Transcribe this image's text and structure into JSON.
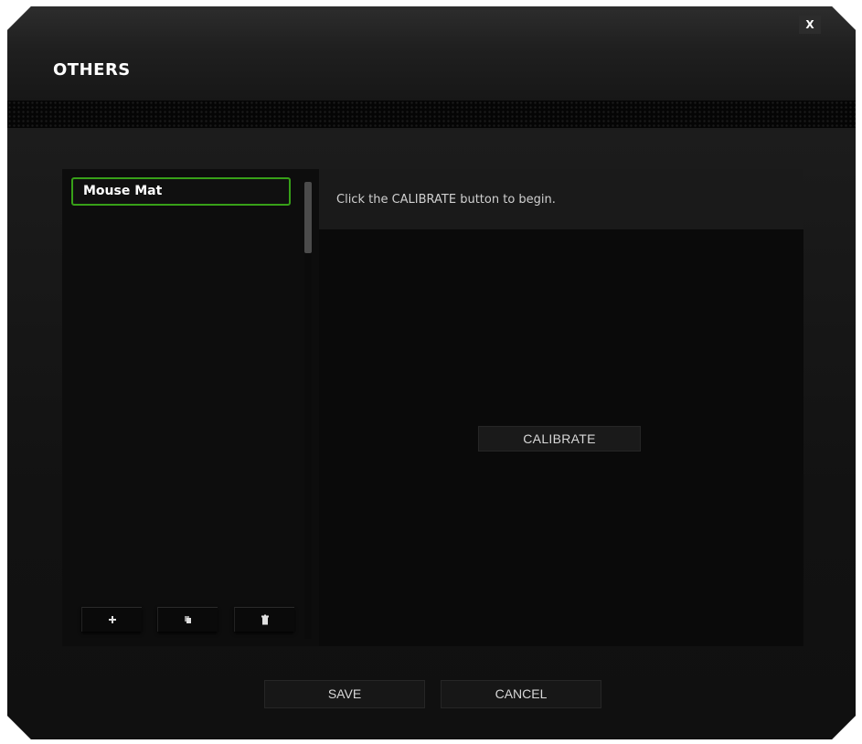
{
  "window": {
    "title": "OTHERS",
    "close_label": "X"
  },
  "profiles": {
    "items": [
      {
        "label": "Mouse Mat",
        "selected": true
      }
    ],
    "add_icon": "plus-icon",
    "duplicate_icon": "copy-icon",
    "delete_icon": "trash-icon"
  },
  "calibration": {
    "instruction": "Click the CALIBRATE button to begin.",
    "calibrate_label": "CALIBRATE"
  },
  "footer": {
    "save_label": "SAVE",
    "cancel_label": "CANCEL"
  },
  "colors": {
    "accent_green": "#37a018",
    "background": "#090909",
    "text": "#ffffff"
  }
}
